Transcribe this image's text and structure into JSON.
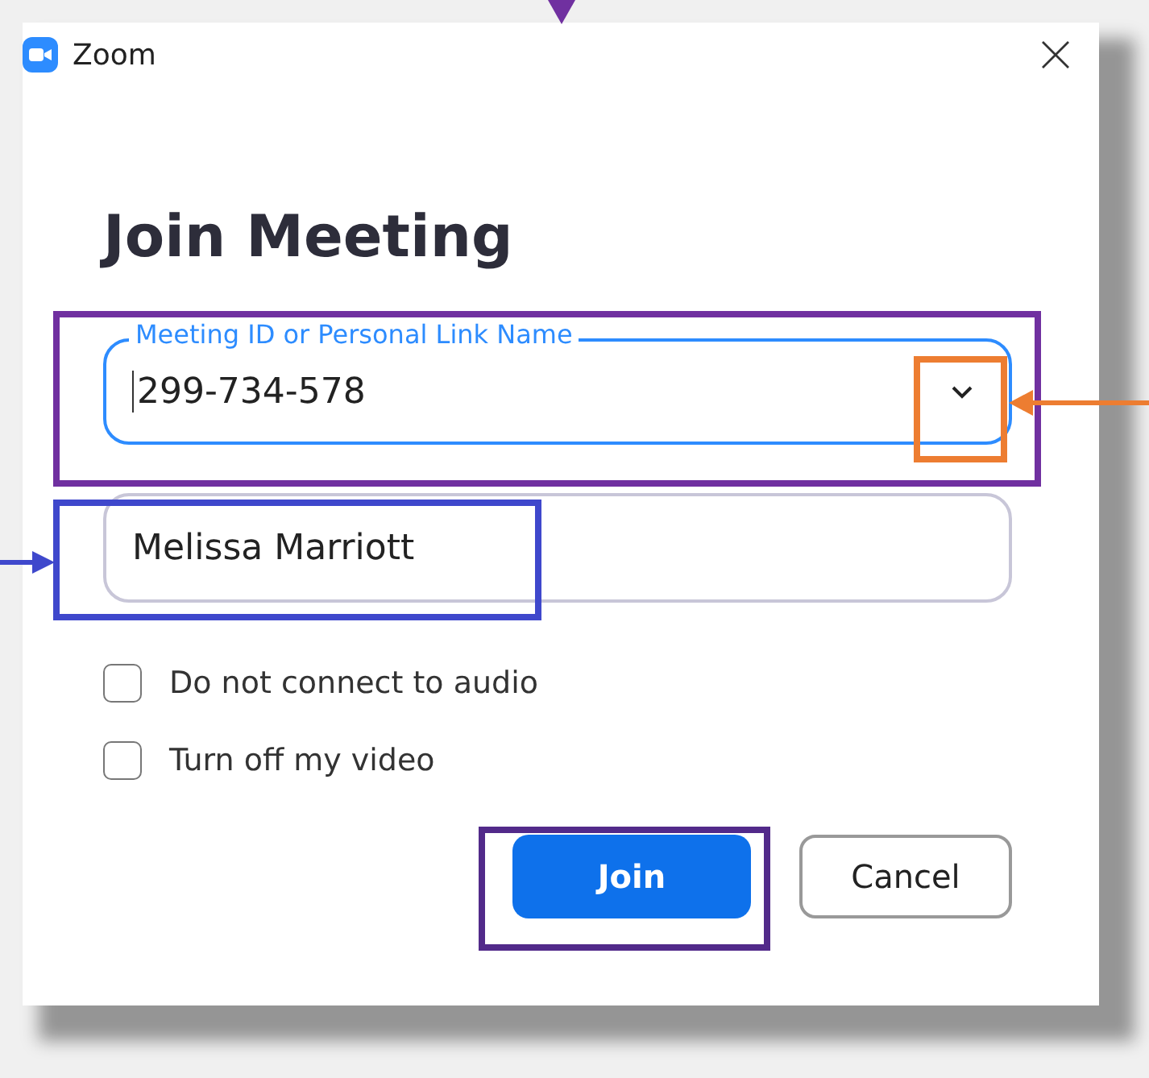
{
  "window": {
    "title": "Zoom"
  },
  "heading": "Join Meeting",
  "meeting_id_field": {
    "label": "Meeting ID or Personal Link Name",
    "value": "299-734-578",
    "focused": true
  },
  "name_field": {
    "value": "Melissa Marriott",
    "focused": false
  },
  "options": [
    {
      "label": "Do not connect to audio",
      "checked": false
    },
    {
      "label": "Turn off my video",
      "checked": false
    }
  ],
  "buttons": [
    {
      "label": "Join",
      "kind": "primary"
    },
    {
      "label": "Cancel",
      "kind": "secondary"
    }
  ]
}
